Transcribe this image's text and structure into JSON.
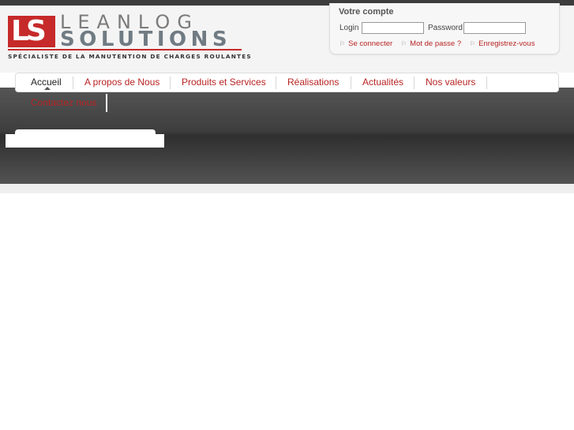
{
  "logo": {
    "line1": "LEANLOG",
    "line2": "SOLUTIONS",
    "mark": "LS",
    "tagline": "SPÉCIALISTE DE LA MANUTENTION DE CHARGES ROULANTES"
  },
  "account": {
    "title": "Votre compte",
    "login_label": "Login",
    "login_value": "",
    "password_label": "Password",
    "password_value": "",
    "links": [
      "Se connecter",
      "Mot de passe ?",
      "Enregistrez-vous"
    ]
  },
  "nav": {
    "items": [
      "Accueil",
      "A propos de Nous",
      "Produits et Services",
      "Réalisations",
      "Actualités",
      "Nos valeurs",
      "Contactez nous"
    ],
    "active": "Accueil"
  },
  "colors": {
    "brand_red": "#c62a2a",
    "link_red": "#b92424",
    "dark_band": "#3e3e3e"
  }
}
